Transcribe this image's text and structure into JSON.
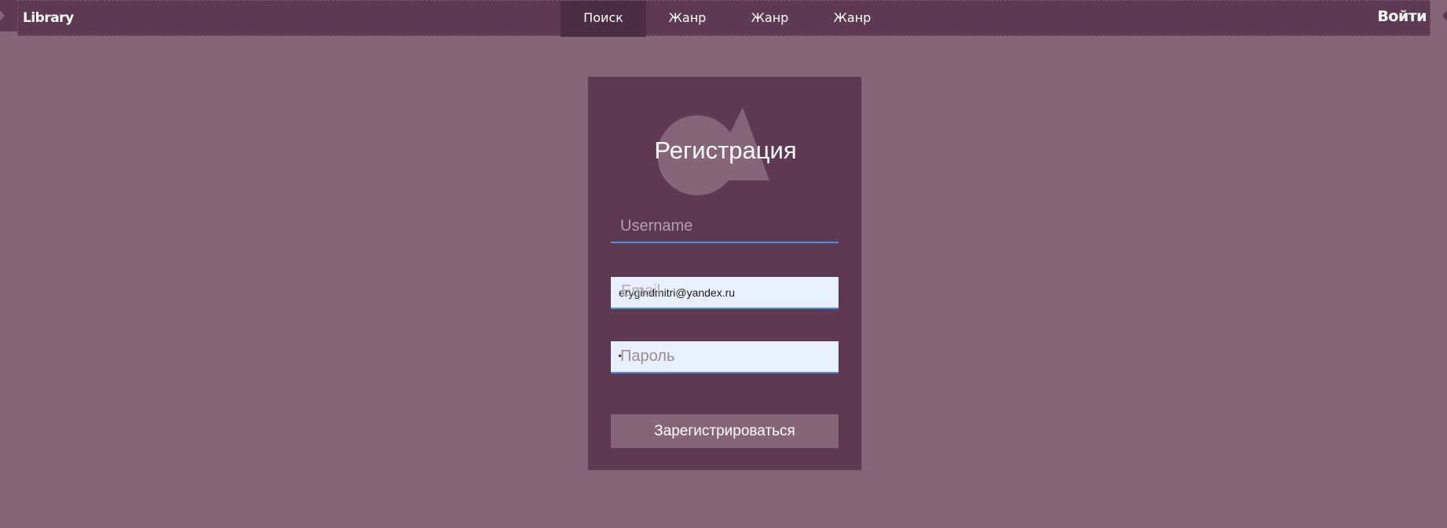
{
  "app": {
    "brand": "Library",
    "login_label": "Войти"
  },
  "nav": {
    "items": [
      {
        "label": "Поиск",
        "active": true
      },
      {
        "label": "Жанр",
        "active": false
      },
      {
        "label": "Жанр",
        "active": false
      },
      {
        "label": "Жанр",
        "active": false
      }
    ]
  },
  "form": {
    "title": "Регистрация",
    "username": {
      "placeholder": "Username",
      "value": ""
    },
    "email": {
      "placeholder": "Email",
      "value": "erygindmitri@yandex.ru"
    },
    "password": {
      "placeholder": "Пароль",
      "masked_value": "•"
    },
    "submit_label": "Зарегистрироваться"
  },
  "colors": {
    "page_background": "#876579",
    "panel_background": "#5d3a52",
    "nav_active_background": "#4c2c42",
    "input_autofill_background": "#e8f0fc",
    "input_focus_underline": "#4f8fd8",
    "text_primary": "#ffffff"
  },
  "icons": {
    "decoration": "circle-and-triangle-shapes",
    "edge_left": "chevron-right-icon",
    "edge_right": "chevron-left-icon"
  }
}
